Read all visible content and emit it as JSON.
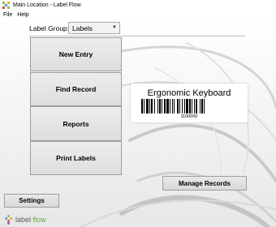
{
  "window": {
    "title": "Main Location - Label Flow",
    "icon": "label-flow-app-icon"
  },
  "menu": {
    "items": [
      "File",
      "Help"
    ]
  },
  "toolbar": {
    "group_label": "Label Group:",
    "group_value": "Labels"
  },
  "actions": {
    "new_entry": "New Entry",
    "find_record": "Find Record",
    "reports": "Reports",
    "print_labels": "Print Labels",
    "manage_records": "Manage Records",
    "settings": "Settings"
  },
  "preview": {
    "title": "Ergonomic Keyboard",
    "number": "1100000"
  },
  "brand": {
    "part1": "label",
    "part2": "flow",
    "accent": "#6aa33a"
  },
  "colors": {
    "button_bg": "#e6e6e6",
    "button_border": "#9d9d9d",
    "brand_green": "#6aa33a"
  }
}
